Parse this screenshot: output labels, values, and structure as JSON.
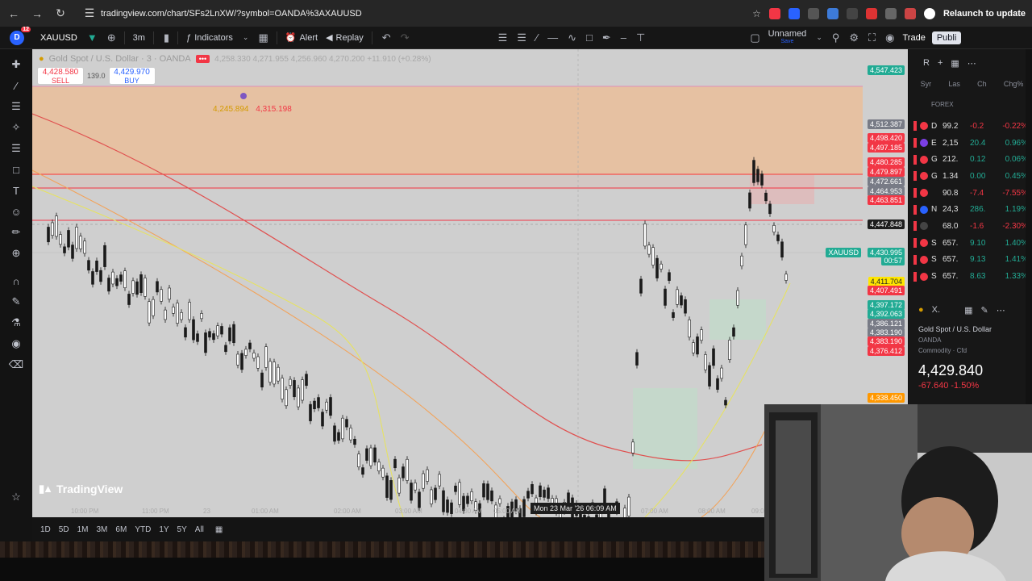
{
  "browser": {
    "url": "tradingview.com/chart/SFs2LnXW/?symbol=OANDA%3AXAUUSD",
    "relaunch_label": "Relaunch to update"
  },
  "toolbar": {
    "badge_count": "12",
    "symbol": "XAUUSD",
    "interval": "3m",
    "indicators_label": "Indicators",
    "alert_label": "Alert",
    "replay_label": "Replay",
    "layout_name": "Unnamed",
    "layout_status": "Save",
    "trade_label": "Trade",
    "publish_label": "Publi"
  },
  "chart": {
    "legend_title": "Gold Spot / U.S. Dollar · 3 · OANDA",
    "ohlc": "4,258.330  4,271.955  4,256.960  4,270.200  +11.910 (+0.28%)",
    "sell_price": "4,428.580",
    "sell_label": "SELL",
    "spread": "139.0",
    "buy_price": "4,429.970",
    "buy_label": "BUY",
    "position_a": "4,245.894",
    "position_b": "4,315.198",
    "watermark": "TradingView",
    "xauusd_tag": "XAUUSD",
    "countdown": "00:57",
    "crosshair_time": "Mon 23 Mar '26   06:09 AM",
    "time_labels": [
      "10:00 PM",
      "11:00 PM",
      "23",
      "01:00 AM",
      "02:00 AM",
      "03:00 AM",
      "04:00 AM",
      "05:00 AM",
      "07:00 AM",
      "08:00 AM",
      "09:00 AM"
    ],
    "price_labels": [
      {
        "text": "4,547.423",
        "color": "#22ab94"
      },
      {
        "text": "4,512.387",
        "color": "#787b86"
      },
      {
        "text": "4,498.420",
        "color": "#f23645"
      },
      {
        "text": "4,497.185",
        "color": "#f23645"
      },
      {
        "text": "4,480.285",
        "color": "#f23645"
      },
      {
        "text": "4,479.897",
        "color": "#f23645"
      },
      {
        "text": "4,472.661",
        "color": "#787b86"
      },
      {
        "text": "4,464.953",
        "color": "#787b86"
      },
      {
        "text": "4,463.851",
        "color": "#f23645"
      },
      {
        "text": "4,447.848",
        "color": "#1e1e1e"
      },
      {
        "text": "4,430.995",
        "color": "#22ab94"
      },
      {
        "text": "4,411.704",
        "color": "#ffe600"
      },
      {
        "text": "4,407.491",
        "color": "#f23645"
      },
      {
        "text": "4,397.172",
        "color": "#22ab94"
      },
      {
        "text": "4,392.063",
        "color": "#22ab94"
      },
      {
        "text": "4,386.121",
        "color": "#787b86"
      },
      {
        "text": "4,383.190",
        "color": "#787b86"
      },
      {
        "text": "4,383.190",
        "color": "#f23645"
      },
      {
        "text": "4,376.412",
        "color": "#f23645"
      },
      {
        "text": "4,338.450",
        "color": "#ff9800"
      }
    ]
  },
  "bottom": {
    "ranges": [
      "1D",
      "5D",
      "1M",
      "3M",
      "6M",
      "YTD",
      "1Y",
      "5Y",
      "All"
    ]
  },
  "watchlist": {
    "header": "R",
    "columns": [
      "Syr",
      "Las",
      "Ch",
      "Chg%"
    ],
    "section": "FOREX",
    "rows": [
      {
        "sym": "D",
        "last": "99.2",
        "chg": "-0.2",
        "pct": "-0.22%",
        "dir": "neg",
        "color": "#f23645"
      },
      {
        "sym": "E",
        "last": "2,15",
        "chg": "20.4",
        "pct": "0.96%",
        "dir": "pos",
        "color": "#7b3fe4"
      },
      {
        "sym": "G",
        "last": "212.",
        "chg": "0.12",
        "pct": "0.06%",
        "dir": "pos",
        "color": "#f23645"
      },
      {
        "sym": "G",
        "last": "1.34",
        "chg": "0.00",
        "pct": "0.45%",
        "dir": "pos",
        "color": "#f23645"
      },
      {
        "sym": "",
        "last": "90.8",
        "chg": "-7.4",
        "pct": "-7.55%",
        "dir": "neg",
        "color": "#f23645"
      },
      {
        "sym": "N",
        "last": "24,3",
        "chg": "286.",
        "pct": "1.19%",
        "dir": "pos",
        "color": "#2962ff"
      },
      {
        "sym": "",
        "last": "68.0",
        "chg": "-1.6",
        "pct": "-2.30%",
        "dir": "neg",
        "color": "#444"
      },
      {
        "sym": "S",
        "last": "657.",
        "chg": "9.10",
        "pct": "1.40%",
        "dir": "pos",
        "color": "#f23645"
      },
      {
        "sym": "S",
        "last": "657.",
        "chg": "9.13",
        "pct": "1.41%",
        "dir": "pos",
        "color": "#f23645"
      },
      {
        "sym": "S",
        "last": "657.",
        "chg": "8.63",
        "pct": "1.33%",
        "dir": "pos",
        "color": "#f23645"
      }
    ],
    "detail": {
      "header": "X.",
      "name": "Gold Spot / U.S. Dollar",
      "exchange": "OANDA",
      "type": "Commodity · Cfd",
      "price": "4,429.840",
      "change": "-67.640  -1.50%"
    }
  }
}
